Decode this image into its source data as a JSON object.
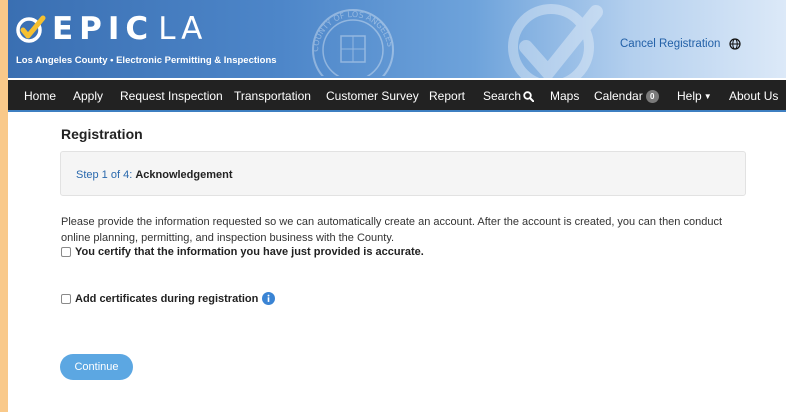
{
  "header": {
    "logo_epic": "EPIC",
    "logo_la": "LA",
    "subtitle": "Los Angeles County • Electronic Permitting & Inspections",
    "seal_text": "COUNTY OF LOS ANGELES",
    "cancel_label": "Cancel Registration",
    "globe_icon": "globe-icon"
  },
  "nav": {
    "items": [
      {
        "label": "Home"
      },
      {
        "label": "Apply"
      },
      {
        "label": "Request Inspection"
      },
      {
        "label": "Transportation"
      },
      {
        "label": "Customer Survey"
      },
      {
        "label": "Report"
      },
      {
        "label": "Search"
      },
      {
        "label": "Maps"
      },
      {
        "label": "Calendar",
        "badge": "0"
      },
      {
        "label": "Help"
      },
      {
        "label": "About Us"
      }
    ]
  },
  "main": {
    "title": "Registration",
    "step_label": "Step 1 of 4:",
    "step_name": "Acknowledgement",
    "intro": "Please provide the information requested so we can automatically create an account.  After the account is created, you can then conduct online planning, permitting, and inspection business with the County.",
    "certify_label": "You certify that the information you have just provided is accurate.",
    "certify_checked": false,
    "certificates_label": "Add certificates during registration",
    "certificates_checked": false,
    "continue_label": "Continue"
  },
  "colors": {
    "header_blue": "#3a6fb2",
    "nav_bg": "#222222",
    "link_blue": "#2361a8",
    "button_blue": "#5ca7e2",
    "border_orange": "#f9c98a"
  }
}
